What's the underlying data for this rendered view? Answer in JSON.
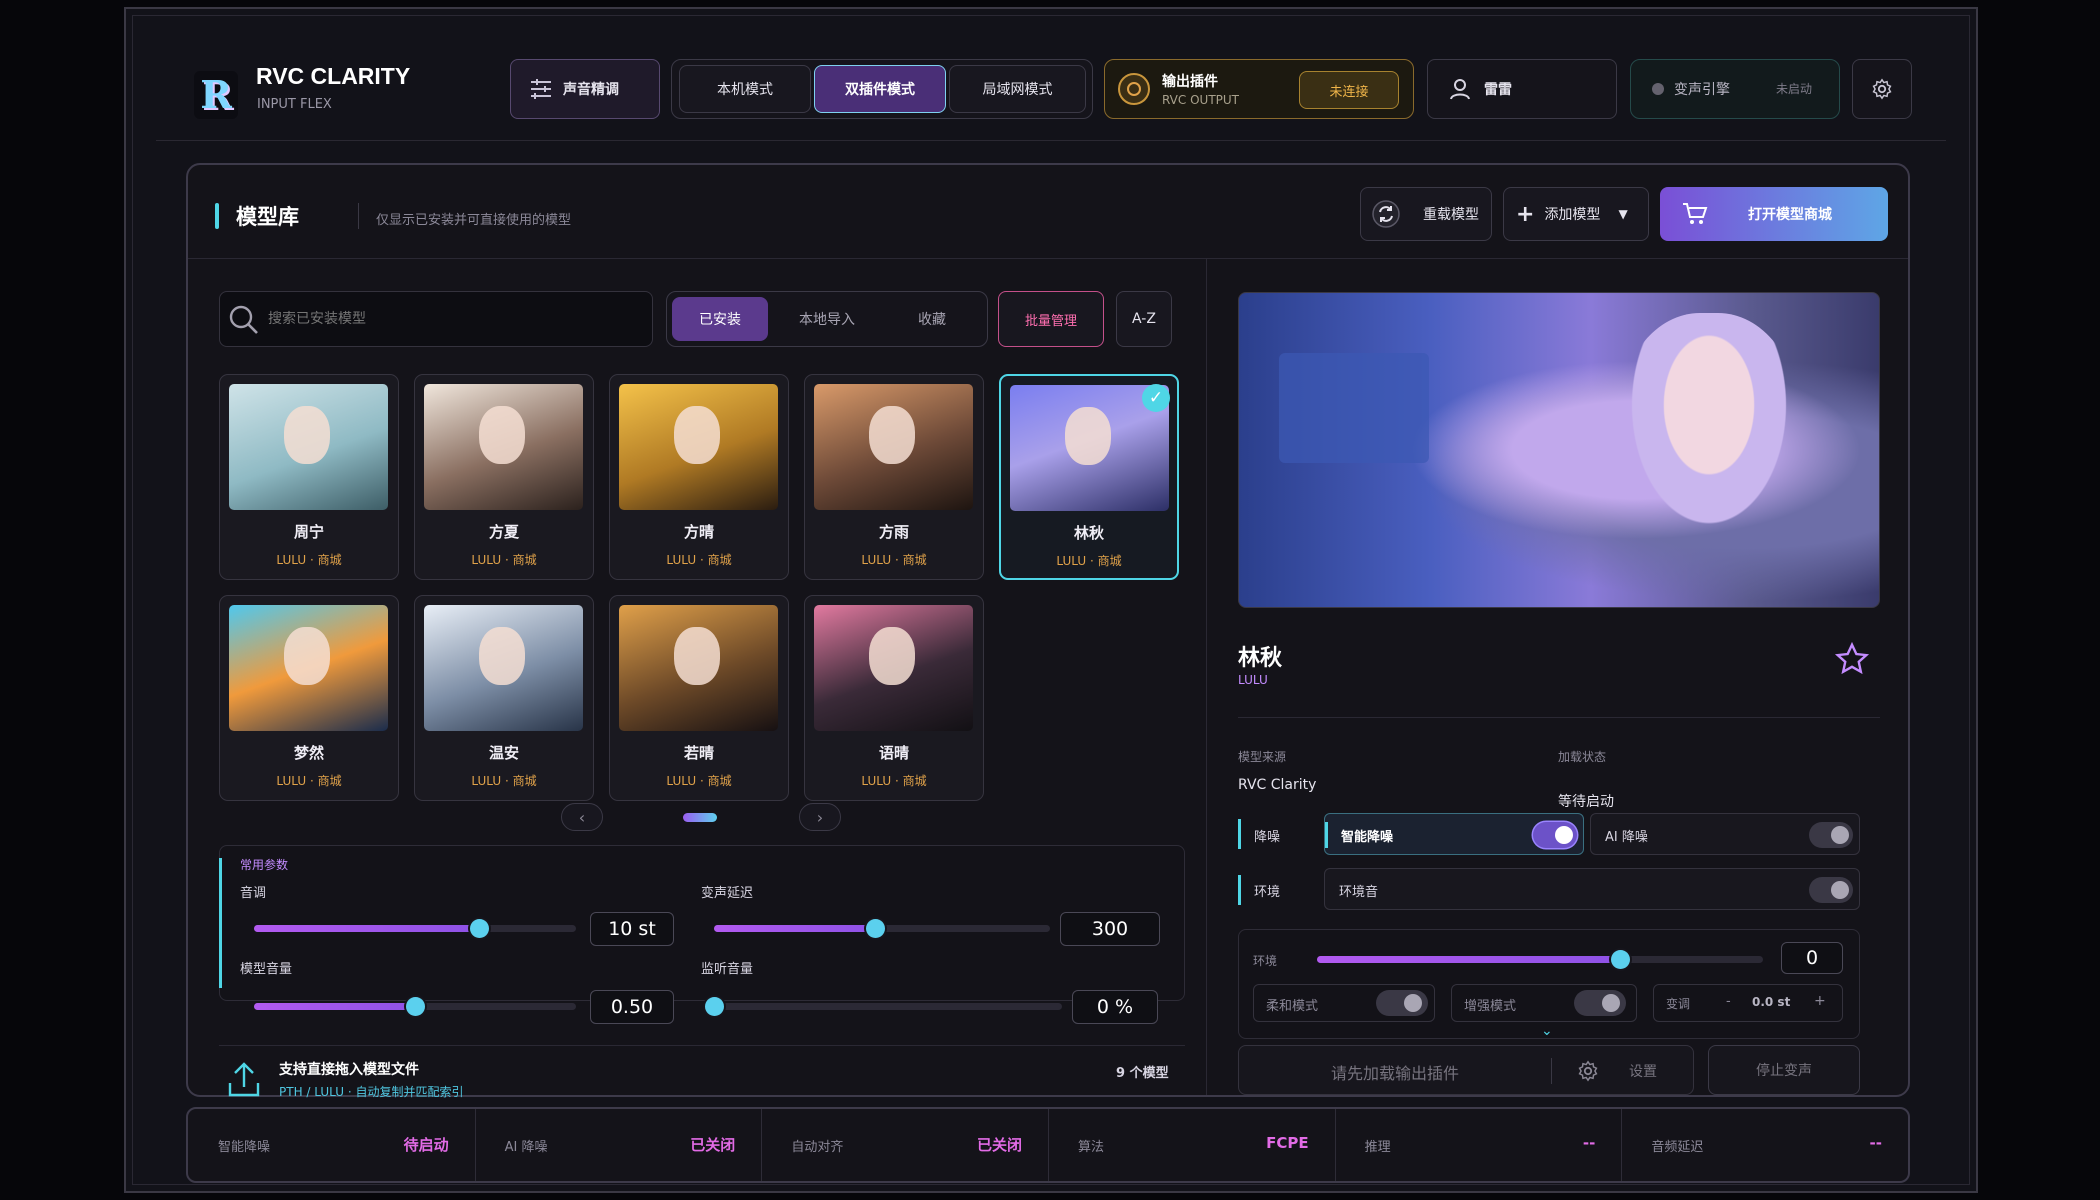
{
  "app": {
    "title": "RVC CLARITY",
    "subtitle": "INPUT FLEX"
  },
  "header": {
    "voice_tune_label": "声音精调",
    "modes": [
      "本机模式",
      "双插件模式",
      "局域网模式"
    ],
    "active_mode": "双插件模式",
    "output_plugin": {
      "title": "输出插件",
      "subtitle": "RVC OUTPUT",
      "status": "未连接"
    },
    "user_name": "雷雷",
    "engine": {
      "label": "变声引擎",
      "status": "未启动"
    }
  },
  "library": {
    "title": "模型库",
    "hint": "仅显示已安装并可直接使用的模型",
    "reload_label": "重载模型",
    "add_label": "添加模型",
    "store_label": "打开模型商城",
    "search_placeholder": "搜索已安装模型",
    "tabs": [
      "已安装",
      "本地导入",
      "收藏"
    ],
    "batch_label": "批量管理",
    "sort_label": "A-Z",
    "models": [
      {
        "name": "周宁",
        "meta": "LULU · 商城"
      },
      {
        "name": "方夏",
        "meta": "LULU · 商城"
      },
      {
        "name": "方晴",
        "meta": "LULU · 商城"
      },
      {
        "name": "方雨",
        "meta": "LULU · 商城"
      },
      {
        "name": "林秋",
        "meta": "LULU · 商城"
      },
      {
        "name": "梦然",
        "meta": "LULU · 商城"
      },
      {
        "name": "温安",
        "meta": "LULU · 商城"
      },
      {
        "name": "若晴",
        "meta": "LULU · 商城"
      },
      {
        "name": "语晴",
        "meta": "LULU · 商城"
      }
    ],
    "selected_index": 4
  },
  "params": {
    "section_title": "常用参数",
    "pitch": {
      "label": "音调",
      "value": "10 st",
      "fraction": 0.7
    },
    "delay": {
      "label": "变声延迟",
      "value": "300",
      "fraction": 0.48
    },
    "model_volume": {
      "label": "模型音量",
      "value": "0.50",
      "fraction": 0.5
    },
    "monitor_volume": {
      "label": "监听音量",
      "value": "0 %",
      "fraction": 0.0
    }
  },
  "dropzone": {
    "title": "支持直接拖入模型文件",
    "sub": "PTH / LULU · 自动复制并匹配索引",
    "count": "9 个模型"
  },
  "detail": {
    "name": "林秋",
    "author": "LULU",
    "source_label": "模型来源",
    "source_value": "RVC Clarity",
    "load_label": "加载状态",
    "load_value": "等待启动",
    "denoise_label": "降噪",
    "smart_denoise": "智能降噪",
    "ai_denoise": "AI 降噪",
    "env_label": "环境",
    "env_sound": "环境音",
    "env_slider_label": "环境",
    "env_value": "0",
    "env_fraction": 0.68,
    "soft_mode": "柔和模式",
    "boost_mode": "增强模式",
    "transpose_label": "变调",
    "transpose_minus": "-",
    "transpose_value": "0.0 st",
    "transpose_plus": "+",
    "load_plugin_label": "请先加载输出插件",
    "settings_label": "设置",
    "stop_label": "停止变声"
  },
  "status_bar": [
    {
      "label": "智能降噪",
      "value": "待启动"
    },
    {
      "label": "AI 降噪",
      "value": "已关闭"
    },
    {
      "label": "自动对齐",
      "value": "已关闭"
    },
    {
      "label": "算法",
      "value": "FCPE"
    },
    {
      "label": "推理",
      "value": "--"
    },
    {
      "label": "音频延迟",
      "value": "--"
    }
  ],
  "colors": {
    "accent_purple": "#8e52e6",
    "accent_cyan": "#4fd6e6",
    "accent_orange": "#e0a24a",
    "status_pink": "#e26be6"
  }
}
